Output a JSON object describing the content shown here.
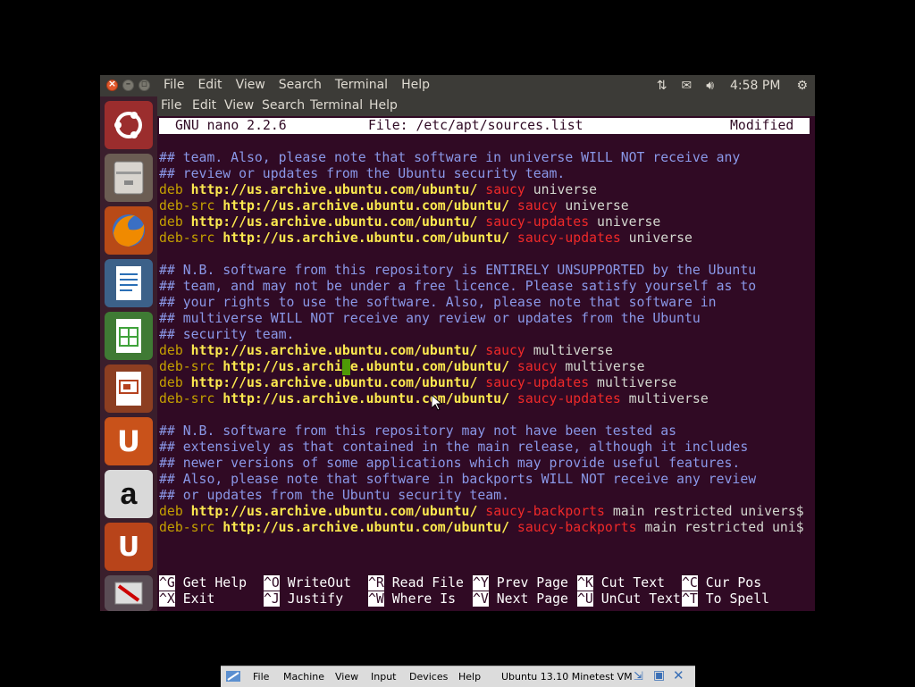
{
  "top_panel": {
    "menu": [
      "File",
      "Edit",
      "View",
      "Search",
      "Terminal",
      "Help"
    ],
    "clock": "4:58 PM",
    "indicators": [
      "network-icon",
      "mail-icon",
      "volume-icon",
      "gear-icon"
    ]
  },
  "launcher": {
    "items": [
      {
        "name": "ubuntu-dash",
        "icon": "ubuntu-logo-icon"
      },
      {
        "name": "files",
        "icon": "file-cabinet-icon"
      },
      {
        "name": "firefox",
        "icon": "firefox-icon"
      },
      {
        "name": "writer",
        "icon": "document-icon"
      },
      {
        "name": "calc",
        "icon": "spreadsheet-icon"
      },
      {
        "name": "impress",
        "icon": "presentation-icon"
      },
      {
        "name": "ubuntu-one",
        "icon": "ubuntu-one-icon",
        "glyph": "U"
      },
      {
        "name": "amazon",
        "icon": "amazon-icon",
        "glyph": "a"
      },
      {
        "name": "ubuntu-one-music",
        "icon": "ubuntu-one-music-icon",
        "glyph": "U"
      },
      {
        "name": "software-updater",
        "icon": "software-updater-icon"
      }
    ],
    "colors": {
      "firefox": "#e66000",
      "writer": "#2a6fb6",
      "calc": "#3fa23a",
      "impress": "#b5421f",
      "ubuntu_one": "#e65c12",
      "amazon": "#ffffff",
      "terminal_bg": "#300a24"
    }
  },
  "terminal_menubar": [
    "File",
    "Edit",
    "View",
    "Search",
    "Terminal",
    "Help"
  ],
  "nano": {
    "version": "GNU nano 2.2.6",
    "file": "File: /etc/apt/sources.list",
    "status": "Modified"
  },
  "lines": [
    {
      "type": "comment",
      "text": "## team. Also, please note that software in universe WILL NOT receive any"
    },
    {
      "type": "comment",
      "text": "## review or updates from the Ubuntu security team."
    },
    {
      "type": "deb",
      "kw": "deb",
      "url": "http://us.archive.ubuntu.com/ubuntu/",
      "dist": "saucy",
      "comp": "universe"
    },
    {
      "type": "deb",
      "kw": "deb-src",
      "url": "http://us.archive.ubuntu.com/ubuntu/",
      "dist": "saucy",
      "comp": "universe"
    },
    {
      "type": "deb",
      "kw": "deb",
      "url": "http://us.archive.ubuntu.com/ubuntu/",
      "dist": "saucy-updates",
      "comp": "universe"
    },
    {
      "type": "deb",
      "kw": "deb-src",
      "url": "http://us.archive.ubuntu.com/ubuntu/",
      "dist": "saucy-updates",
      "comp": "universe"
    },
    {
      "type": "blank",
      "text": ""
    },
    {
      "type": "comment",
      "text": "## N.B. software from this repository is ENTIRELY UNSUPPORTED by the Ubuntu"
    },
    {
      "type": "comment",
      "text": "## team, and may not be under a free licence. Please satisfy yourself as to"
    },
    {
      "type": "comment",
      "text": "## your rights to use the software. Also, please note that software in"
    },
    {
      "type": "comment",
      "text": "## multiverse WILL NOT receive any review or updates from the Ubuntu"
    },
    {
      "type": "comment",
      "text": "## security team."
    },
    {
      "type": "deb",
      "kw": "deb",
      "url": "http://us.archive.ubuntu.com/ubuntu/",
      "dist": "saucy",
      "comp": "multiverse"
    },
    {
      "type": "deb",
      "kw": "deb-src",
      "url": "http://us.archive.ubuntu.com/ubuntu/",
      "dist": "saucy",
      "comp": "multiverse"
    },
    {
      "type": "deb",
      "kw": "deb",
      "url": "http://us.archive.ubuntu.com/ubuntu/",
      "dist": "saucy-updates",
      "comp": "multiverse"
    },
    {
      "type": "deb",
      "kw": "deb-src",
      "url": "http://us.archive.ubuntu.com/ubuntu/",
      "dist": "saucy-updates",
      "comp": "multiverse"
    },
    {
      "type": "blank",
      "text": ""
    },
    {
      "type": "comment",
      "text": "## N.B. software from this repository may not have been tested as"
    },
    {
      "type": "comment",
      "text": "## extensively as that contained in the main release, although it includes"
    },
    {
      "type": "comment",
      "text": "## newer versions of some applications which may provide useful features."
    },
    {
      "type": "comment",
      "text": "## Also, please note that software in backports WILL NOT receive any review"
    },
    {
      "type": "comment",
      "text": "## or updates from the Ubuntu security team."
    },
    {
      "type": "deb",
      "kw": "deb",
      "url": "http://us.archive.ubuntu.com/ubuntu/",
      "dist": "saucy-backports",
      "comp": "main restricted univers$"
    },
    {
      "type": "deb",
      "kw": "deb-src",
      "url": "http://us.archive.ubuntu.com/ubuntu/",
      "dist": "saucy-backports",
      "comp": "main restricted uni$"
    }
  ],
  "shortcuts_row1": [
    {
      "key": "^G",
      "label": "Get Help"
    },
    {
      "key": "^O",
      "label": "WriteOut"
    },
    {
      "key": "^R",
      "label": "Read File"
    },
    {
      "key": "^Y",
      "label": "Prev Page"
    },
    {
      "key": "^K",
      "label": "Cut Text"
    },
    {
      "key": "^C",
      "label": "Cur Pos"
    }
  ],
  "shortcuts_row2": [
    {
      "key": "^X",
      "label": "Exit"
    },
    {
      "key": "^J",
      "label": "Justify"
    },
    {
      "key": "^W",
      "label": "Where Is"
    },
    {
      "key": "^V",
      "label": "Next Page"
    },
    {
      "key": "^U",
      "label": "UnCut Text"
    },
    {
      "key": "^T",
      "label": "To Spell"
    }
  ],
  "vbox_bar": {
    "menu": [
      "File",
      "Machine",
      "View",
      "Input",
      "Devices",
      "Help"
    ],
    "vm_name": "Ubuntu 13.10 Minetest VM"
  }
}
